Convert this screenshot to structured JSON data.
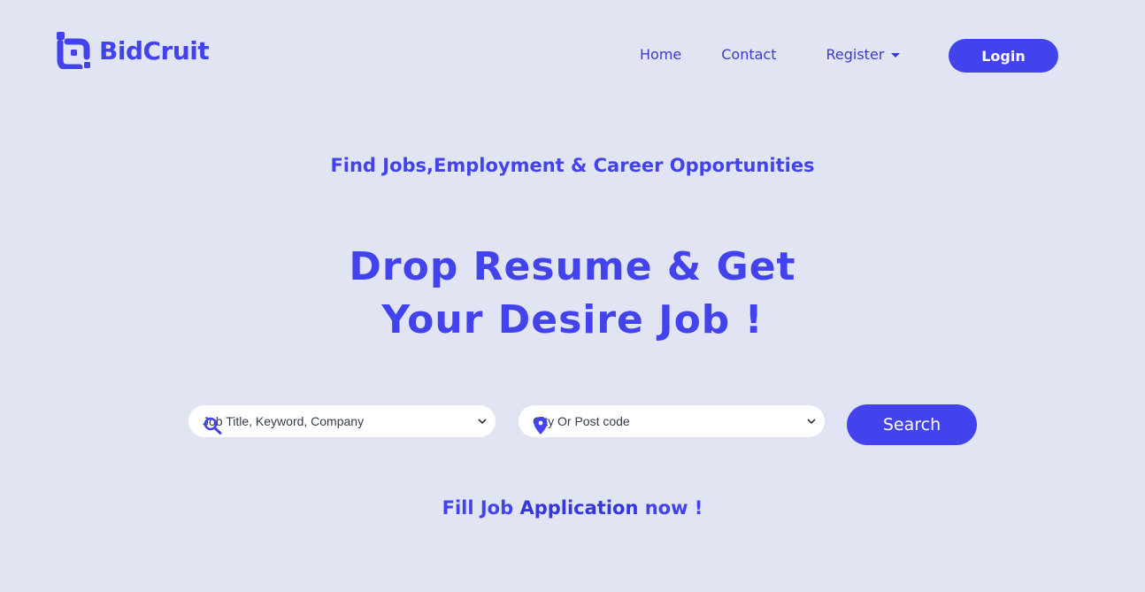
{
  "brand": {
    "name": "BidCruit",
    "color": "#4343ee"
  },
  "nav": {
    "home": "Home",
    "contact": "Contact",
    "register": "Register",
    "login": "Login"
  },
  "hero": {
    "tagline": "Find Jobs,Employment & Career Opportunities",
    "headline_line1": "Drop Resume & Get",
    "headline_line2": "Your Desire Job !"
  },
  "search": {
    "job_select_value": "Job Title, Keyword, Company",
    "job_icon": "search-icon",
    "location_select_value": "City Or Post code",
    "location_icon": "map-pin-icon",
    "button_label": "Search"
  },
  "cta": {
    "prefix": "Fill Job ",
    "emphasis": "Application",
    "suffix": " now !"
  },
  "colors": {
    "background": "#e1e4f3",
    "accent": "#4343ee",
    "input_background": "#ffffff"
  }
}
